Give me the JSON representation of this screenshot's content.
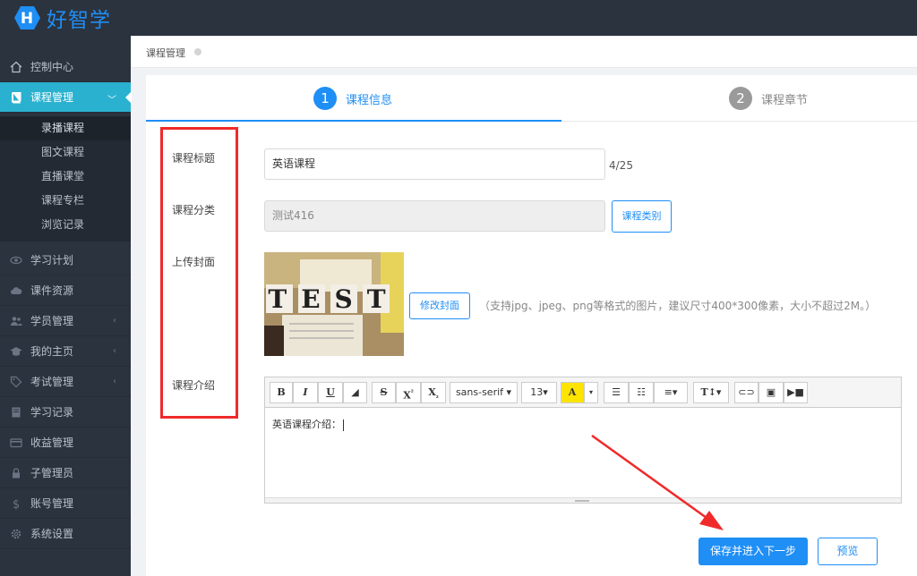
{
  "brand": {
    "logo_letter": "H",
    "name": "好智学"
  },
  "colors": {
    "accent": "#1f8ef5",
    "sidebar_active": "#2ab1cf",
    "sidebar_bg": "#2b333e",
    "annotation": "#f02a2a"
  },
  "sidebar": {
    "items": [
      {
        "label": "控制中心",
        "icon": "home-icon"
      },
      {
        "label": "课程管理",
        "icon": "book-icon",
        "active": true,
        "expanded": true
      },
      {
        "label": "学习计划",
        "icon": "eye-icon"
      },
      {
        "label": "课件资源",
        "icon": "cloud-icon"
      },
      {
        "label": "学员管理",
        "icon": "users-icon",
        "has_submenu": true
      },
      {
        "label": "我的主页",
        "icon": "graduation-cap-icon",
        "has_submenu": true
      },
      {
        "label": "考试管理",
        "icon": "tag-icon",
        "has_submenu": true
      },
      {
        "label": "学习记录",
        "icon": "notebook-icon"
      },
      {
        "label": "收益管理",
        "icon": "credit-card-icon"
      },
      {
        "label": "子管理员",
        "icon": "lock-icon"
      },
      {
        "label": "账号管理",
        "icon": "dollar-icon"
      },
      {
        "label": "系统设置",
        "icon": "gear-icon"
      }
    ],
    "subitems": [
      "录播课程",
      "图文课程",
      "直播课堂",
      "课程专栏",
      "浏览记录"
    ]
  },
  "breadcrumb": {
    "current": "课程管理"
  },
  "steps": [
    {
      "num": "1",
      "label": "课程信息",
      "active": true
    },
    {
      "num": "2",
      "label": "课程章节",
      "active": false
    }
  ],
  "form": {
    "title_label": "课程标题",
    "title_value": "英语课程",
    "title_counter": "4/25",
    "category_label": "课程分类",
    "category_value": "测试416",
    "category_button": "课程类别",
    "cover_label": "上传封面",
    "cover_image_text": "TEST",
    "cover_button": "修改封面",
    "cover_hint": "（支持jpg、jpeg、png等格式的图片，建议尺寸400*300像素，大小不超过2M。）",
    "intro_label": "课程介绍"
  },
  "editor": {
    "toolbar": {
      "bold": "B",
      "italic": "I",
      "underline": "U",
      "strike": "S",
      "superscript": "X",
      "subscript": "X",
      "font_family": "sans-serif ▾",
      "font_size": "13▾",
      "font_color": "A",
      "heading": "T↕▾"
    },
    "content": "英语课程介绍："
  },
  "actions": {
    "save_next": "保存并进入下一步",
    "preview": "预览"
  }
}
